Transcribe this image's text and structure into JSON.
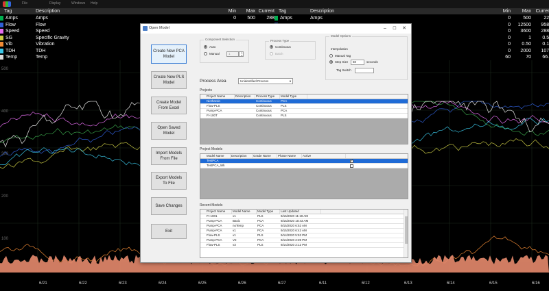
{
  "menubar": {
    "items": [
      "File",
      "Display",
      "Windows",
      "Help"
    ]
  },
  "tag_tables": [
    {
      "headers": {
        "tag": "Tag",
        "description": "Description",
        "min": "Min",
        "max": "Max",
        "current": "Current"
      },
      "rows": [
        {
          "color": "#00b050",
          "tag": "Amps",
          "description": "Amps",
          "min": "0",
          "max": "500",
          "current": "288"
        },
        {
          "color": "#2f5fd7",
          "tag": "Flow",
          "description": "Flow",
          "min": "",
          "max": "",
          "current": ""
        },
        {
          "color": "#e56df0",
          "tag": "Speed",
          "description": "Speed",
          "min": "",
          "max": "",
          "current": ""
        },
        {
          "color": "#cccc44",
          "tag": "SG",
          "description": "Specific Gravity",
          "min": "",
          "max": "",
          "current": ""
        },
        {
          "color": "#f28b35",
          "tag": "Vib",
          "description": "Vibration",
          "min": "",
          "max": "",
          "current": ""
        },
        {
          "color": "#39c7e8",
          "tag": "TDH",
          "description": "TDH",
          "min": "",
          "max": "",
          "current": ""
        },
        {
          "color": "#d9d9d9",
          "tag": "Temp",
          "description": "Temp",
          "min": "",
          "max": "",
          "current": ""
        }
      ]
    },
    {
      "headers": {
        "tag": "Tag",
        "description": "Description",
        "min": "Min",
        "max": "Max",
        "current": "Current"
      },
      "rows": [
        {
          "color": "#00b050",
          "tag": "Amps",
          "description": "Amps",
          "min": "0",
          "max": "500",
          "current": "223"
        },
        {
          "color": "#2f5fd7",
          "tag": "",
          "description": "",
          "min": "0",
          "max": "12500",
          "current": "9582"
        },
        {
          "color": "#e56df0",
          "tag": "",
          "description": "",
          "min": "0",
          "max": "3600",
          "current": "2883"
        },
        {
          "color": "#cccc44",
          "tag": "",
          "description": "",
          "min": "0",
          "max": "1",
          "current": "0.58"
        },
        {
          "color": "#f28b35",
          "tag": "",
          "description": "",
          "min": "0",
          "max": "0.50",
          "current": "0.10"
        },
        {
          "color": "#39c7e8",
          "tag": "",
          "description": "",
          "min": "0",
          "max": "2000",
          "current": "1073"
        },
        {
          "color": "#d9d9d9",
          "tag": "",
          "description": "",
          "min": "60",
          "max": "70",
          "current": "66.7"
        }
      ]
    }
  ],
  "trend": {
    "left_ticks": [
      "6/21",
      "6/22",
      "6/23",
      "6/24",
      "6/25",
      "6/26",
      "6/27"
    ],
    "right_ticks": [
      "6/11",
      "6/12",
      "6/13",
      "6/14",
      "6/15",
      "6/16"
    ],
    "y_labels": [
      "500",
      "400",
      "300",
      "200",
      "100"
    ],
    "line_colors": [
      "#3aa34a",
      "#2f5fd7",
      "#e56df0",
      "#cccc44",
      "#f28b35",
      "#39c7e8",
      "#f0f0f0"
    ]
  },
  "dialog": {
    "title": "Open Model",
    "side_buttons": [
      "Create New PCA Model",
      "Create New PLS Model",
      "Create Model From Excel",
      "Open Saved Model",
      "Import Models From File",
      "Export Models To File",
      "Save Changes",
      "Exit"
    ],
    "component_selection": {
      "legend": "Component Selection",
      "auto": "Auto",
      "manual": "Manual",
      "manual_value": "1"
    },
    "process_type": {
      "legend": "Process Type",
      "continuous": "Continuous",
      "batch": "Batch"
    },
    "model_options": {
      "legend": "Model Options",
      "interpolation": "Interpolation",
      "manual_tag": "Manual Tag",
      "step_size": "Step Size",
      "step_value": "60",
      "seconds": "seconds",
      "tag_switch": "Tag Switch"
    },
    "process_area": {
      "label": "Process Area",
      "value": "Unidentified Process"
    },
    "projects": {
      "label": "Projects",
      "columns": [
        "Project Name",
        "Description",
        "Process Type",
        "Model Type"
      ],
      "rows": [
        [
          "Nictharsin",
          "",
          "Continuous",
          "PCA"
        ],
        [
          "Flow-PLS",
          "",
          "Continuous",
          "PLS"
        ],
        [
          "Pump-PCA",
          "",
          "Continuous",
          "PCA"
        ],
        [
          "FI-100T",
          "",
          "Continuous",
          "PLS"
        ]
      ]
    },
    "project_models": {
      "label": "Project Models",
      "columns": [
        "Model Name",
        "Description",
        "Grade Name",
        "Phase Name",
        "Active"
      ],
      "rows": [
        {
          "name": "TestPCA",
          "active": true
        },
        {
          "name": "TestPCA_Wk",
          "active": false
        }
      ]
    },
    "recent_models": {
      "label": "Recent Models",
      "columns": [
        "Project Name",
        "Model Name",
        "Model Type",
        "Last Updated"
      ],
      "rows": [
        [
          "FI-1001",
          "v1",
          "PLS",
          "9/15/2020 11:19 AM"
        ],
        [
          "Pump-PCA",
          "Basic",
          "PCA",
          "9/15/2020 10:43 AM"
        ],
        [
          "Pump-PCA",
          "noTemp",
          "PCA",
          "9/15/2020 6:52 AM"
        ],
        [
          "Pump-PCA",
          "v1",
          "PCA",
          "9/15/2020 6:42 AM"
        ],
        [
          "Flow-PLS",
          "v1",
          "PLS",
          "9/14/2020 5:53 PM"
        ],
        [
          "Pump-PCA",
          "V2",
          "PCA",
          "9/14/2020 2:39 PM"
        ],
        [
          "Flow-PLS",
          "v3",
          "PLS",
          "9/14/2020 2:12 PM"
        ]
      ]
    }
  }
}
